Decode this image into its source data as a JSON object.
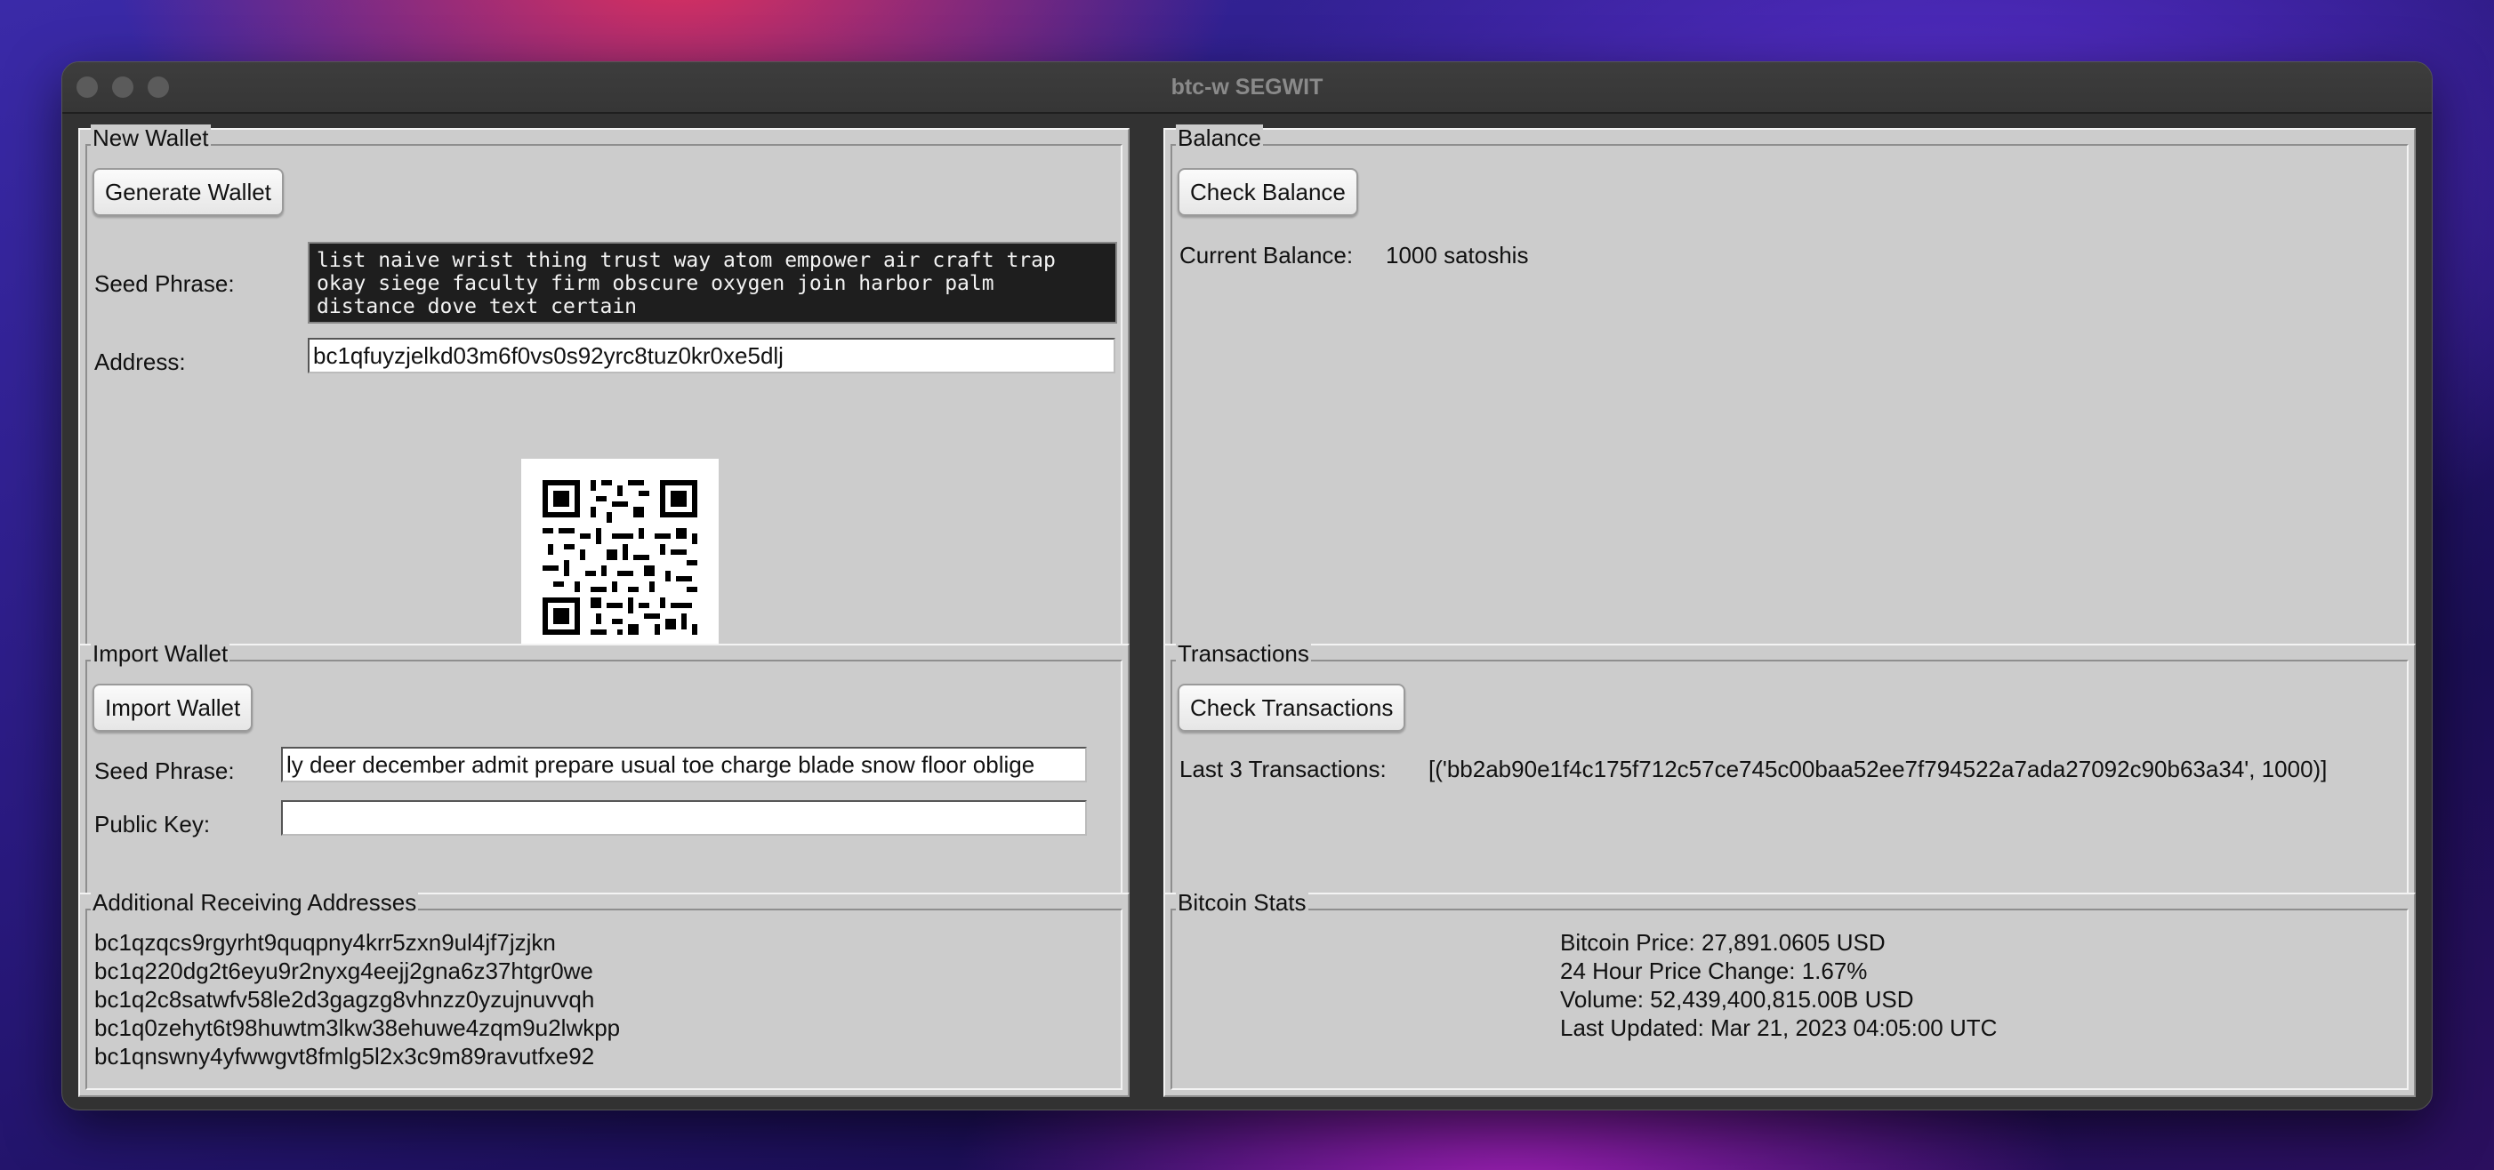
{
  "window": {
    "title": "btc-w SEGWIT"
  },
  "new_wallet": {
    "legend": "New Wallet",
    "generate_button": "Generate Wallet",
    "seed_label": "Seed Phrase:",
    "seed_value": "list naive wrist thing trust way atom empower air craft trap\nokay siege faculty firm obscure oxygen join harbor palm\ndistance dove text certain",
    "address_label": "Address:",
    "address_value": "bc1qfuyzjelkd03m6f0vs0s92yrc8tuz0kr0xe5dlj"
  },
  "balance": {
    "legend": "Balance",
    "check_button": "Check Balance",
    "current_label": "Current Balance:",
    "current_value": "1000 satoshis"
  },
  "import_wallet": {
    "legend": "Import Wallet",
    "import_button": "Import Wallet",
    "seed_label": "Seed Phrase:",
    "seed_value": "ly deer december admit prepare usual toe charge blade snow floor oblige",
    "pubkey_label": "Public Key:",
    "pubkey_value": ""
  },
  "transactions": {
    "legend": "Transactions",
    "check_button": "Check Transactions",
    "last_label": "Last 3 Transactions:",
    "last_value": "[('bb2ab90e1f4c175f712c57ce745c00baa52ee7f794522a7ada27092c90b63a34', 1000)]"
  },
  "receiving": {
    "legend": "Additional Receiving Addresses",
    "addresses": [
      "bc1qzqcs9rgyrht9quqpny4krr5zxn9ul4jf7jzjkn",
      "bc1q220dg2t6eyu9r2nyxg4eejj2gna6z37htgr0we",
      "bc1q2c8satwfv58le2d3gagzg8vhnzz0yzujnuvvqh",
      "bc1q0zehyt6t98huwtm3lkw38ehuwe4zqm9u2lwkpp",
      "bc1qnswny4yfwwgvt8fmlg5l2x3c9m89ravutfxe92"
    ]
  },
  "stats": {
    "legend": "Bitcoin Stats",
    "price": "Bitcoin Price: 27,891.0605 USD",
    "change": "24 Hour Price Change: 1.67%",
    "volume": "Volume: 52,439,400,815.00B USD",
    "updated": "Last Updated: Mar 21, 2023 04:05:00 UTC"
  },
  "colors": {
    "panel": "#cccccc",
    "window": "#323232",
    "seed_bg": "#1e1e1e"
  },
  "icons": [
    "close-dot-icon",
    "minimize-dot-icon",
    "zoom-dot-icon",
    "qr-code-icon"
  ]
}
